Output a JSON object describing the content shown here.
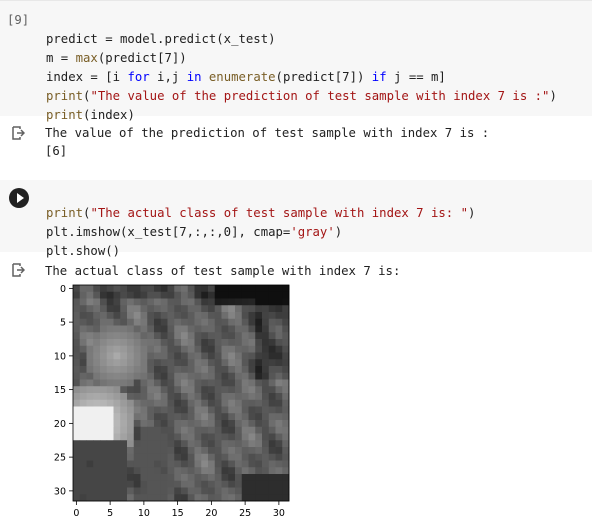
{
  "cell1": {
    "prompt": "[9]",
    "lines": {
      "l1": "predict = model.predict(x_test)",
      "l2a": "m = ",
      "l2b": "max",
      "l2c": "(predict[7])",
      "l3a": "index = [i ",
      "l3b": "for",
      "l3c": " i,j ",
      "l3d": "in",
      "l3e": " ",
      "l3f": "enumerate",
      "l3g": "(predict[7]) ",
      "l3h": "if",
      "l3i": " j == m]",
      "l4a": "print",
      "l4b": "(",
      "l4c": "\"The value of the prediction of test sample with index 7 is :\"",
      "l4d": ")",
      "l5a": "print",
      "l5b": "(index)"
    }
  },
  "output1": {
    "line1": "The value of the prediction of test sample with index 7 is :",
    "line2": "[6]"
  },
  "cell2": {
    "lines": {
      "l1a": "print",
      "l1b": "(",
      "l1c": "\"The actual class of test sample with index 7 is: \"",
      "l1d": ")",
      "l2a": "plt.imshow(x_test[7,:,:,0], cmap=",
      "l2b": "'gray'",
      "l2c": ")",
      "l3": "plt.show()"
    }
  },
  "output2": {
    "line1": "The actual class of test sample with index 7 is:"
  },
  "chart_data": {
    "type": "heatmap",
    "colormap": "gray",
    "grid": false,
    "xlim": [
      -0.5,
      31.5
    ],
    "ylim": [
      31.5,
      -0.5
    ],
    "x_ticks": [
      "0",
      "5",
      "10",
      "15",
      "20",
      "25",
      "30"
    ],
    "y_ticks": [
      "0",
      "5",
      "10",
      "15",
      "20",
      "25",
      "30"
    ]
  }
}
